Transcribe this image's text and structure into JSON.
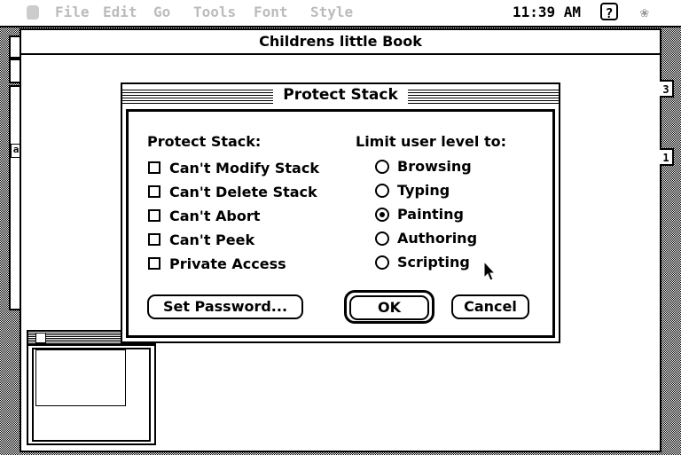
{
  "menubar": {
    "apple": "",
    "items": [
      "File",
      "Edit",
      "Go",
      "Tools",
      "Font",
      "Style"
    ],
    "clock": "11:39 AM",
    "help_symbol": "?"
  },
  "window": {
    "title": "Childrens little Book"
  },
  "side_tabs": [
    "3",
    "1"
  ],
  "left_strip_label": "a",
  "dialog": {
    "title": "Protect Stack",
    "protect_header": "Protect Stack:",
    "checkboxes": [
      {
        "label": "Can't Modify Stack",
        "checked": false
      },
      {
        "label": "Can't Delete Stack",
        "checked": false
      },
      {
        "label": "Can't Abort",
        "checked": false
      },
      {
        "label": "Can't Peek",
        "checked": false
      },
      {
        "label": "Private Access",
        "checked": false
      }
    ],
    "limit_header": "Limit user level to:",
    "levels": [
      {
        "label": "Browsing",
        "selected": false
      },
      {
        "label": "Typing",
        "selected": false
      },
      {
        "label": "Painting",
        "selected": true
      },
      {
        "label": "Authoring",
        "selected": false
      },
      {
        "label": "Scripting",
        "selected": false
      }
    ],
    "buttons": {
      "password": "Set Password...",
      "ok": "OK",
      "cancel": "Cancel"
    }
  },
  "icons": [
    "apple-icon",
    "help-icon",
    "app-icon",
    "arrow-cursor-icon"
  ]
}
